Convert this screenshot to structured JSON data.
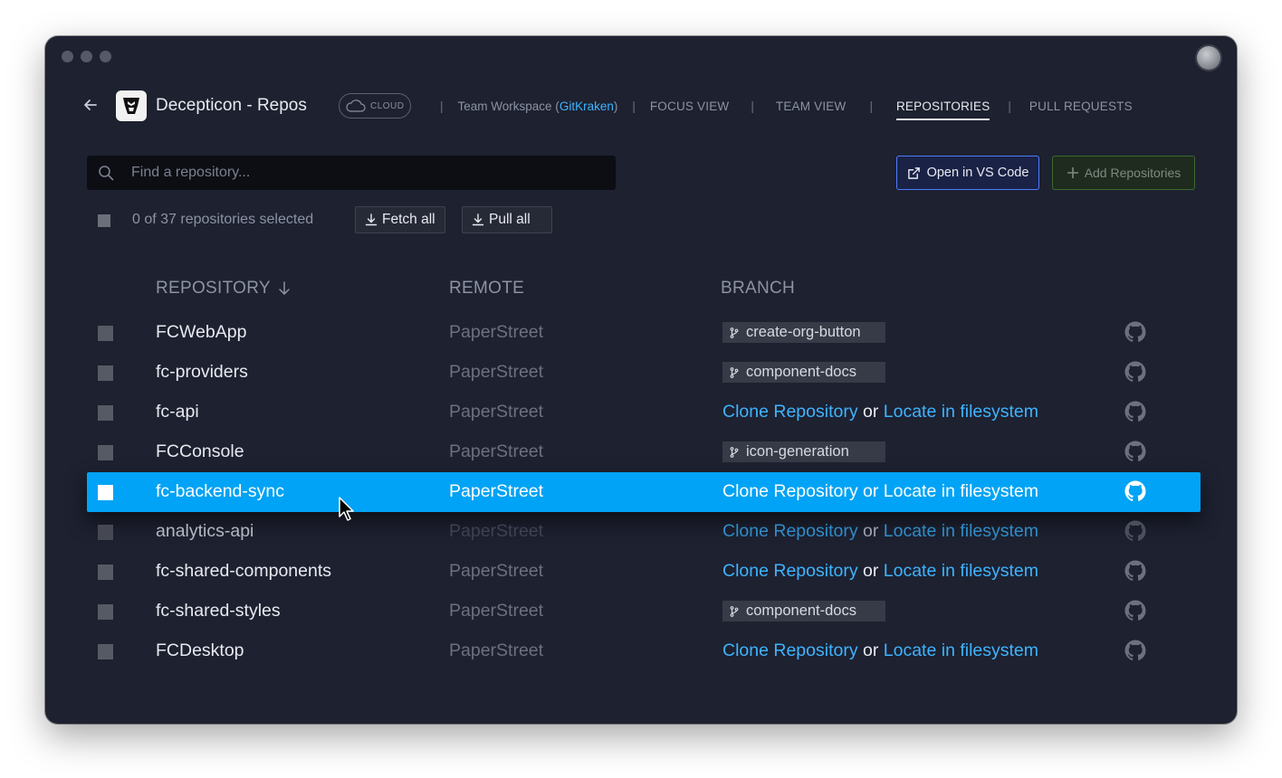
{
  "header": {
    "title": "Decepticon - Repos",
    "cloud_badge": "CLOUD",
    "workspace_prefix": "Team Workspace (",
    "workspace_link": "GitKraken",
    "workspace_suffix": ")",
    "tabs": [
      {
        "label": "FOCUS VIEW"
      },
      {
        "label": "TEAM VIEW"
      },
      {
        "label": "REPOSITORIES"
      },
      {
        "label": "PULL REQUESTS"
      }
    ],
    "active_tab": "REPOSITORIES"
  },
  "search": {
    "placeholder": "Find a repository..."
  },
  "actions": {
    "open_vscode": "Open in VS Code",
    "add_repos": "Add Repositories"
  },
  "bulk": {
    "selected_text": "0 of 37 repositories selected",
    "fetch_all": "Fetch all",
    "pull_all": "Pull all"
  },
  "columns": {
    "repository": "REPOSITORY",
    "remote": "REMOTE",
    "branch": "BRANCH"
  },
  "clone_text": {
    "clone": "Clone Repository",
    "or": " or ",
    "locate": "Locate in filesystem"
  },
  "rows": [
    {
      "name": "FCWebApp",
      "remote": "PaperStreet",
      "branch": "create-org-button"
    },
    {
      "name": "fc-providers",
      "remote": "PaperStreet",
      "branch": "component-docs"
    },
    {
      "name": "fc-api",
      "remote": "PaperStreet",
      "branch": ""
    },
    {
      "name": "FCConsole",
      "remote": "PaperStreet",
      "branch": "icon-generation"
    },
    {
      "name": "fc-backend-sync",
      "remote": "PaperStreet",
      "branch": ""
    },
    {
      "name": "analytics-api",
      "remote": "PaperStreet",
      "branch": ""
    },
    {
      "name": "fc-shared-components",
      "remote": "PaperStreet",
      "branch": ""
    },
    {
      "name": "fc-shared-styles",
      "remote": "PaperStreet",
      "branch": "component-docs"
    },
    {
      "name": "FCDesktop",
      "remote": "PaperStreet",
      "branch": ""
    }
  ],
  "selected_row": "fc-backend-sync",
  "dimmed_row": "analytics-api",
  "colors": {
    "accent": "#00a3f5",
    "link": "#3fb3ff",
    "background": "#1d2130"
  }
}
